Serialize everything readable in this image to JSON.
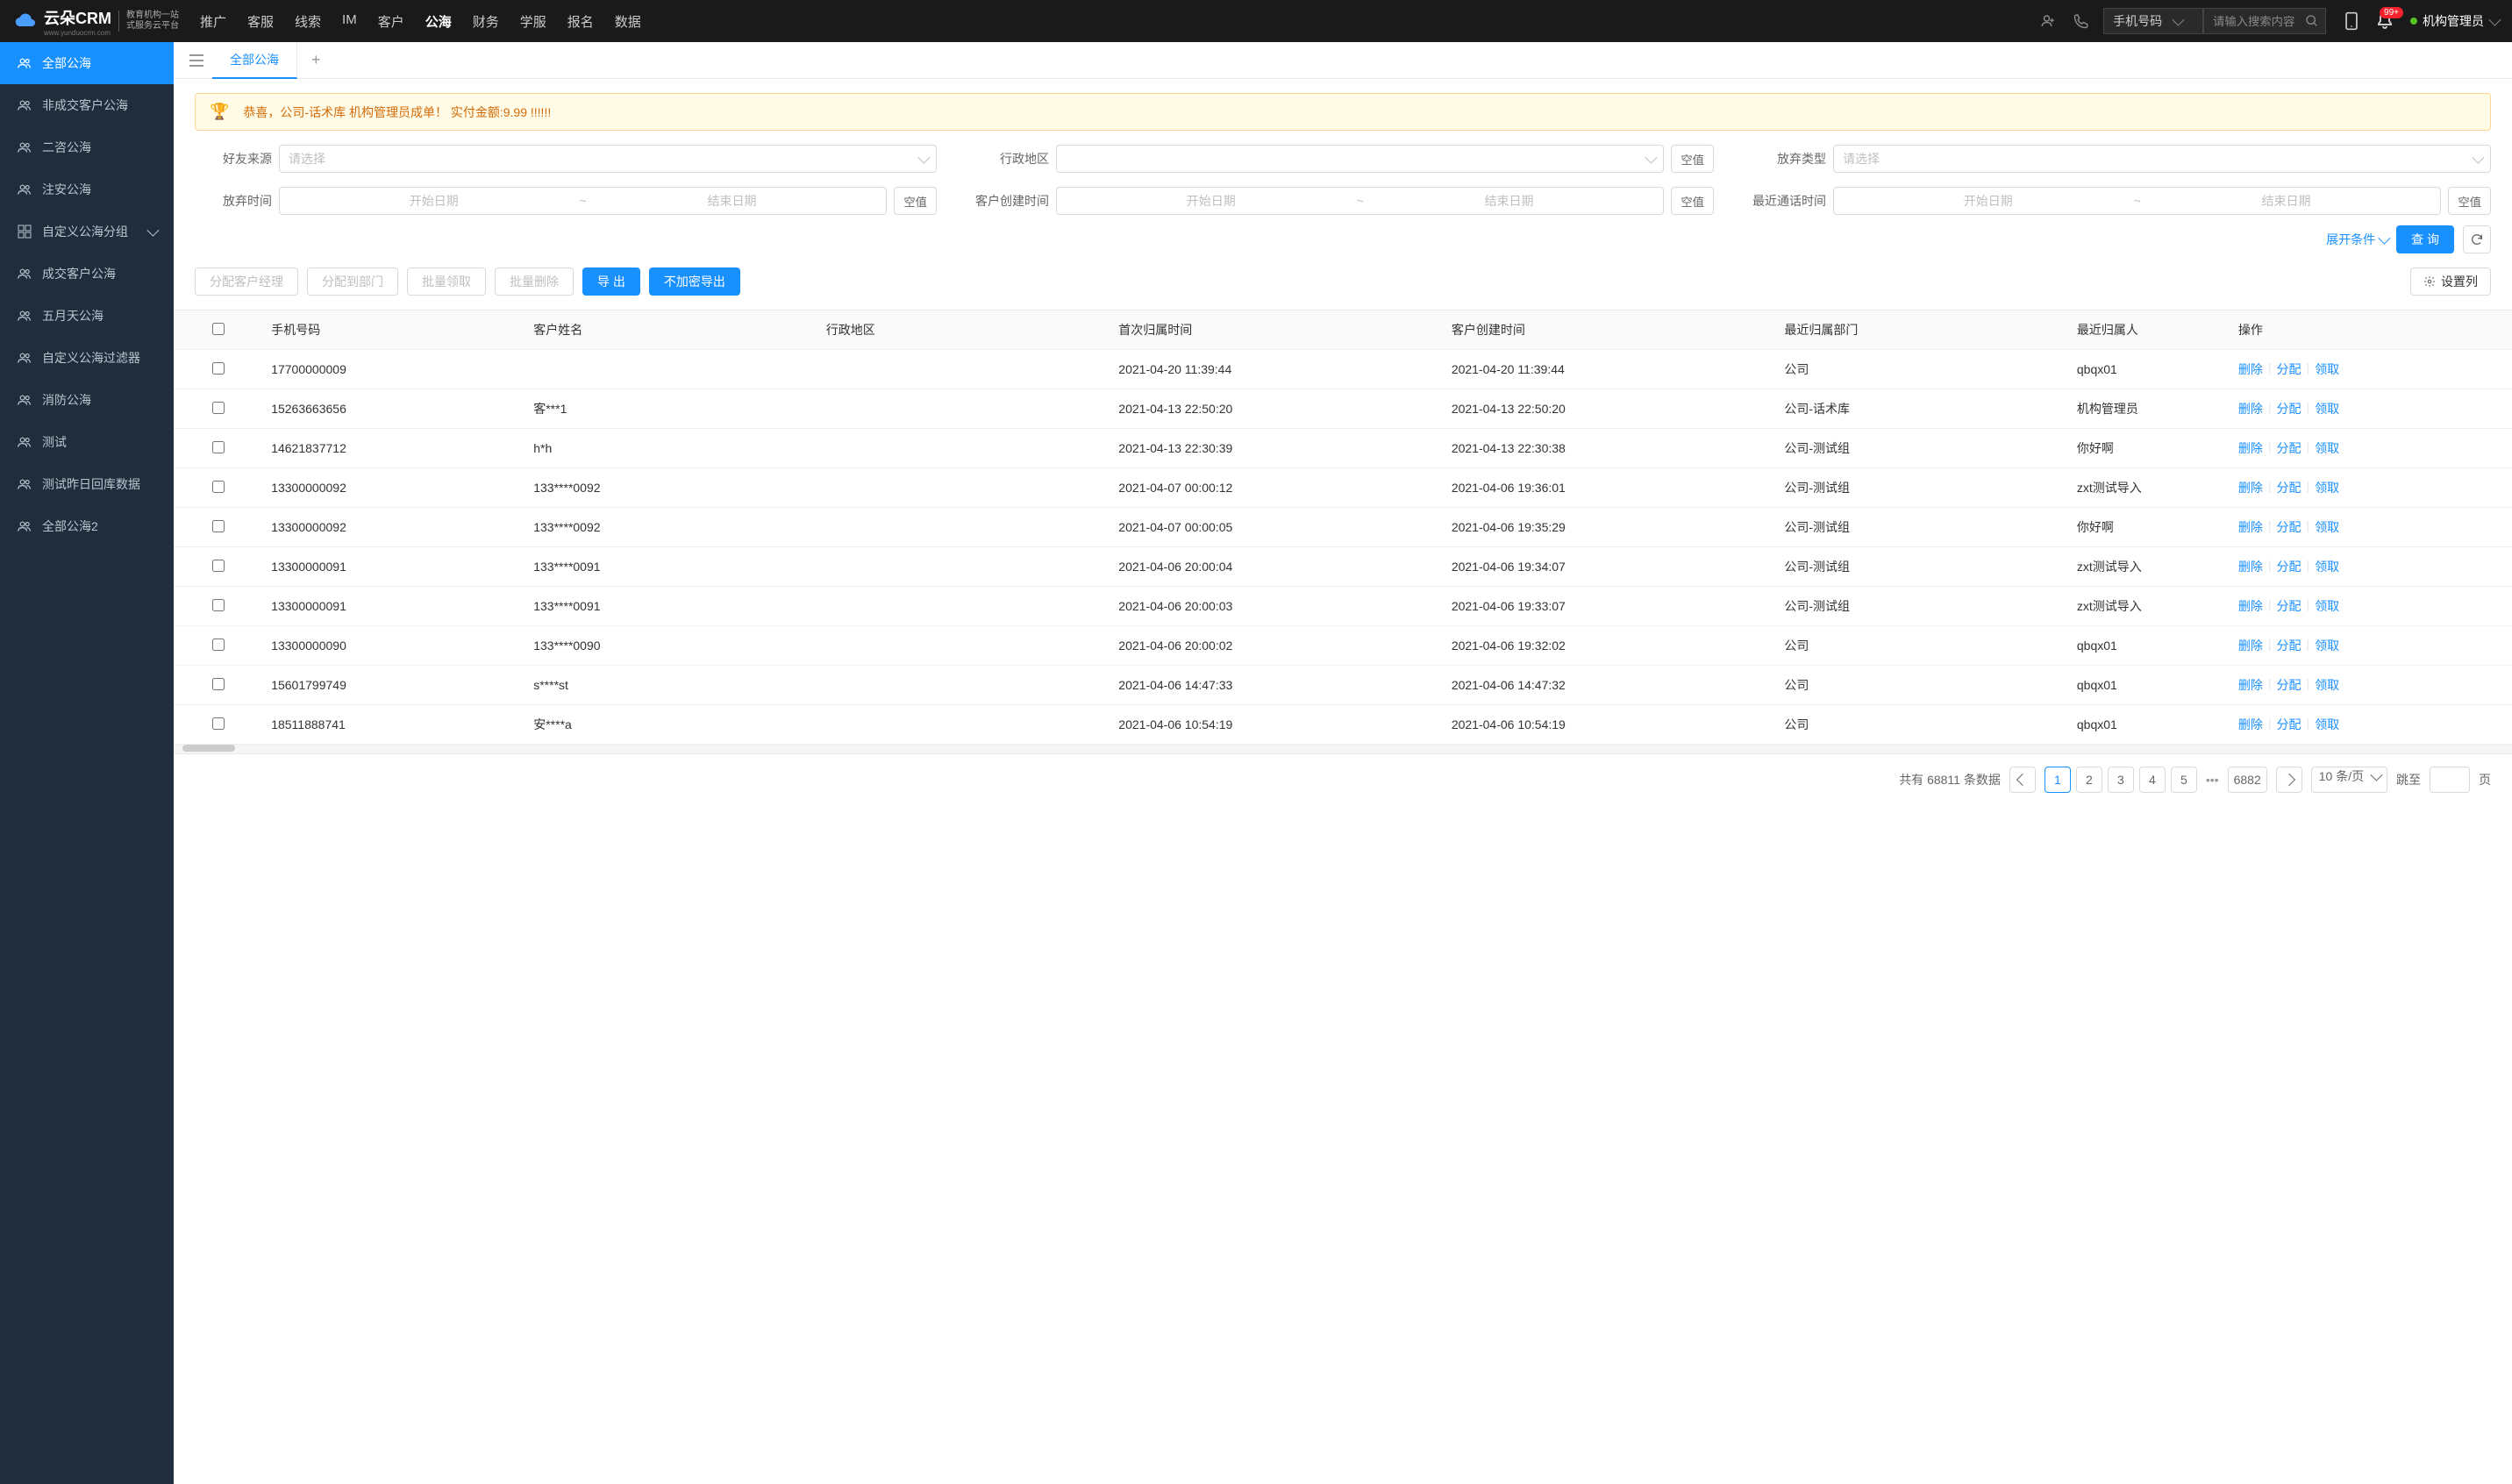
{
  "header": {
    "logo_main": "云朵CRM",
    "logo_sub1": "教育机构一站",
    "logo_sub2": "式服务云平台",
    "logo_url": "www.yunduocrm.com",
    "nav": [
      "推广",
      "客服",
      "线索",
      "IM",
      "客户",
      "公海",
      "财务",
      "学服",
      "报名",
      "数据"
    ],
    "nav_active": 5,
    "search_type": "手机号码",
    "search_placeholder": "请输入搜索内容",
    "badge": "99+",
    "user": "机构管理员"
  },
  "sidebar": {
    "items": [
      {
        "label": "全部公海",
        "icon": "users"
      },
      {
        "label": "非成交客户公海",
        "icon": "users"
      },
      {
        "label": "二咨公海",
        "icon": "users"
      },
      {
        "label": "注安公海",
        "icon": "users"
      },
      {
        "label": "自定义公海分组",
        "icon": "grid",
        "arrow": true
      },
      {
        "label": "成交客户公海",
        "icon": "users"
      },
      {
        "label": "五月天公海",
        "icon": "users"
      },
      {
        "label": "自定义公海过滤器",
        "icon": "users"
      },
      {
        "label": "消防公海",
        "icon": "users"
      },
      {
        "label": "测试",
        "icon": "users"
      },
      {
        "label": "测试昨日回库数据",
        "icon": "users"
      },
      {
        "label": "全部公海2",
        "icon": "users"
      }
    ],
    "active": 0
  },
  "tabs": {
    "items": [
      "全部公海"
    ],
    "active": 0
  },
  "banner": "恭喜，公司-话术库  机构管理员成单！  实付金额:9.99 !!!!!!",
  "filters": {
    "friend_source": {
      "label": "好友来源",
      "placeholder": "请选择"
    },
    "region": {
      "label": "行政地区",
      "placeholder": "",
      "empty": "空值"
    },
    "abandon_type": {
      "label": "放弃类型",
      "placeholder": "请选择"
    },
    "abandon_time": {
      "label": "放弃时间",
      "start": "开始日期",
      "end": "结束日期",
      "empty": "空值"
    },
    "create_time": {
      "label": "客户创建时间",
      "start": "开始日期",
      "end": "结束日期",
      "empty": "空值"
    },
    "call_time": {
      "label": "最近通话时间",
      "start": "开始日期",
      "end": "结束日期",
      "empty": "空值"
    }
  },
  "actions": {
    "expand": "展开条件",
    "query": "查 询"
  },
  "toolbar": {
    "assign_manager": "分配客户经理",
    "assign_dept": "分配到部门",
    "batch_claim": "批量领取",
    "batch_delete": "批量删除",
    "export": "导 出",
    "export_plain": "不加密导出",
    "set_columns": "设置列"
  },
  "table": {
    "headers": [
      "手机号码",
      "客户姓名",
      "行政地区",
      "首次归属时间",
      "客户创建时间",
      "最近归属部门",
      "最近归属人",
      "操作"
    ],
    "action_labels": {
      "delete": "删除",
      "assign": "分配",
      "claim": "领取"
    },
    "rows": [
      {
        "phone": "17700000009",
        "name": "",
        "region": "",
        "first_time": "2021-04-20 11:39:44",
        "create_time": "2021-04-20 11:39:44",
        "dept": "公司",
        "person": "qbqx01"
      },
      {
        "phone": "15263663656",
        "name": "客***1",
        "region": "",
        "first_time": "2021-04-13 22:50:20",
        "create_time": "2021-04-13 22:50:20",
        "dept": "公司-话术库",
        "person": "机构管理员"
      },
      {
        "phone": "14621837712",
        "name": "h*h",
        "region": "",
        "first_time": "2021-04-13 22:30:39",
        "create_time": "2021-04-13 22:30:38",
        "dept": "公司-测试组",
        "person": "你好啊"
      },
      {
        "phone": "13300000092",
        "name": "133****0092",
        "region": "",
        "first_time": "2021-04-07 00:00:12",
        "create_time": "2021-04-06 19:36:01",
        "dept": "公司-测试组",
        "person": "zxt测试导入"
      },
      {
        "phone": "13300000092",
        "name": "133****0092",
        "region": "",
        "first_time": "2021-04-07 00:00:05",
        "create_time": "2021-04-06 19:35:29",
        "dept": "公司-测试组",
        "person": "你好啊"
      },
      {
        "phone": "13300000091",
        "name": "133****0091",
        "region": "",
        "first_time": "2021-04-06 20:00:04",
        "create_time": "2021-04-06 19:34:07",
        "dept": "公司-测试组",
        "person": "zxt测试导入"
      },
      {
        "phone": "13300000091",
        "name": "133****0091",
        "region": "",
        "first_time": "2021-04-06 20:00:03",
        "create_time": "2021-04-06 19:33:07",
        "dept": "公司-测试组",
        "person": "zxt测试导入"
      },
      {
        "phone": "13300000090",
        "name": "133****0090",
        "region": "",
        "first_time": "2021-04-06 20:00:02",
        "create_time": "2021-04-06 19:32:02",
        "dept": "公司",
        "person": "qbqx01"
      },
      {
        "phone": "15601799749",
        "name": "s****st",
        "region": "",
        "first_time": "2021-04-06 14:47:33",
        "create_time": "2021-04-06 14:47:32",
        "dept": "公司",
        "person": "qbqx01"
      },
      {
        "phone": "18511888741",
        "name": "安****a",
        "region": "",
        "first_time": "2021-04-06 10:54:19",
        "create_time": "2021-04-06 10:54:19",
        "dept": "公司",
        "person": "qbqx01"
      }
    ]
  },
  "pagination": {
    "total_prefix": "共有",
    "total": "68811",
    "total_suffix": "条数据",
    "pages": [
      "1",
      "2",
      "3",
      "4",
      "5"
    ],
    "last": "6882",
    "per_page": "10 条/页",
    "jump_label": "跳至",
    "page_suffix": "页"
  }
}
